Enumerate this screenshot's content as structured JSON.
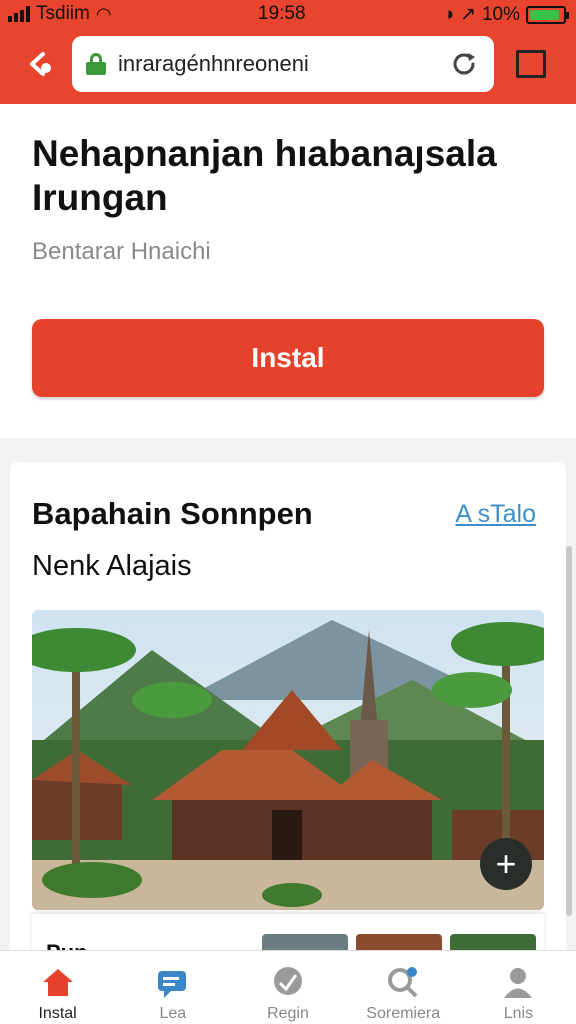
{
  "status_bar": {
    "carrier": "Tsdiim",
    "time": "19:58",
    "battery_text": "10%",
    "battery_level": 0.9
  },
  "browser": {
    "url": "inraragénhnreoneni"
  },
  "hero": {
    "title": "Nehapnanjan hıabanaȷsala Irungan",
    "subtitle": "Bentarar Hnaichi",
    "install_label": "Instal"
  },
  "section": {
    "title": "Bapahain Sonnpen",
    "link": "A sTalo",
    "subtitle": "Nenk Alajais"
  },
  "strip": {
    "text": "Pun"
  },
  "bottom_nav": [
    {
      "label": "Instal",
      "icon": "home-icon"
    },
    {
      "label": "Lea",
      "icon": "chat-icon"
    },
    {
      "label": "Regin",
      "icon": "location-icon"
    },
    {
      "label": "Soremiera",
      "icon": "search-icon"
    },
    {
      "label": "Lnis",
      "icon": "user-icon"
    }
  ],
  "colors": {
    "accent": "#e6422b",
    "link": "#3f8ec8"
  }
}
